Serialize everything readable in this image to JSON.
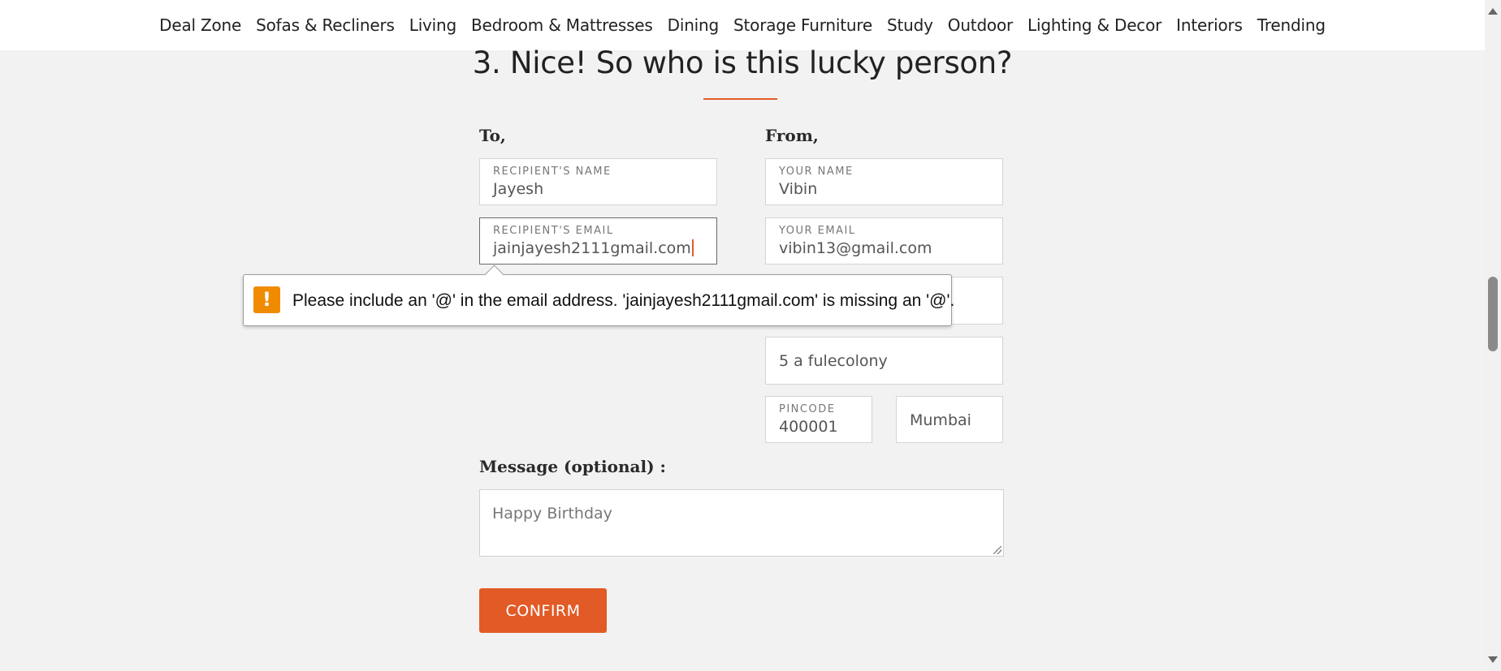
{
  "nav": {
    "items": [
      "Deal Zone",
      "Sofas & Recliners",
      "Living",
      "Bedroom & Mattresses",
      "Dining",
      "Storage Furniture",
      "Study",
      "Outdoor",
      "Lighting & Decor",
      "Interiors",
      "Trending"
    ]
  },
  "heading": "3. Nice! So who is this lucky person?",
  "to": {
    "label": "To,",
    "name_label": "RECIPIENT'S NAME",
    "name_value": "Jayesh",
    "email_label": "RECIPIENT'S EMAIL",
    "email_value": "jainjayesh2111gmail.com"
  },
  "from": {
    "label": "From,",
    "name_label": "YOUR NAME",
    "name_value": "Vibin",
    "email_label": "YOUR EMAIL",
    "email_value": "vibin13@gmail.com",
    "address_value": "5 a fulecolony",
    "pincode_label": "PINCODE",
    "pincode_value": "400001",
    "city_value": "Mumbai"
  },
  "tooltip": {
    "icon": "warning-icon",
    "message": "Please include an '@' in the email address. 'jainjayesh2111gmail.com' is missing an '@'."
  },
  "message": {
    "label": "Message (optional) :",
    "value": "Happy Birthday"
  },
  "confirm_label": "CONFIRM",
  "colors": {
    "accent": "#e25a26",
    "warning": "#f08a00",
    "background": "#f2f2f2"
  }
}
